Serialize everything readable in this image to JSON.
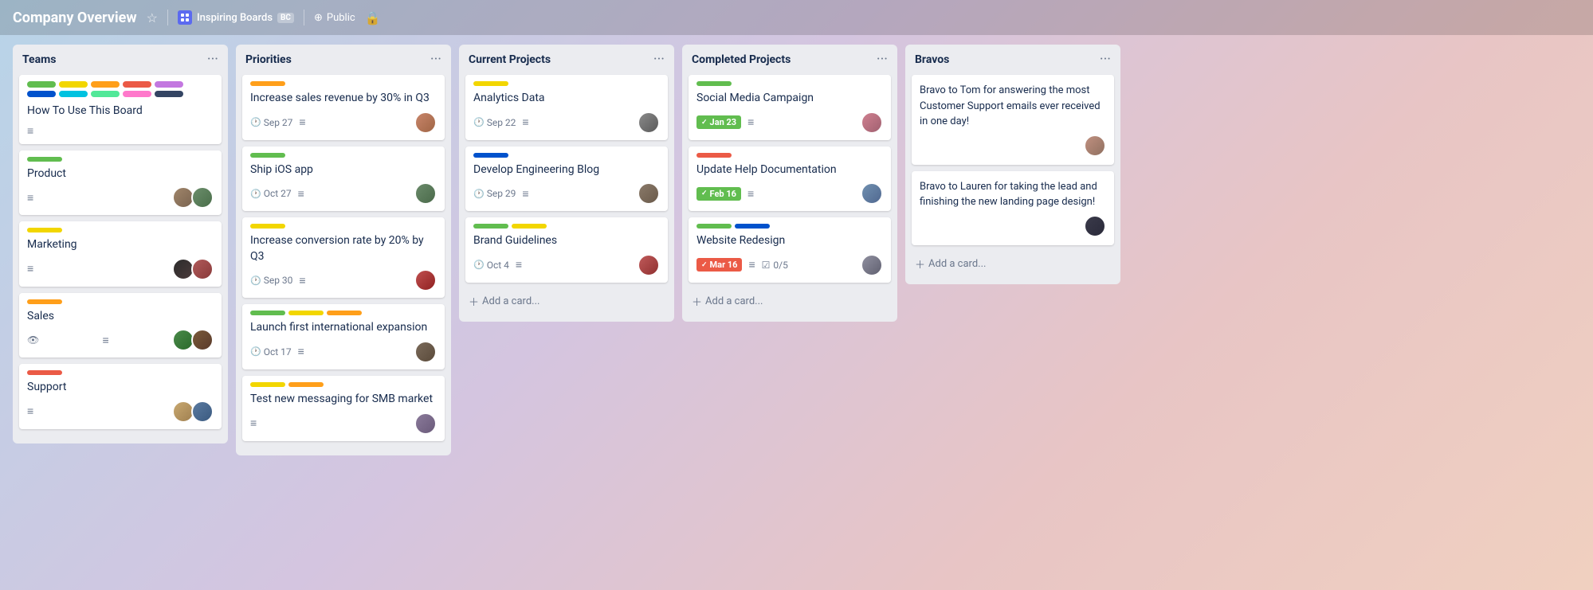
{
  "header": {
    "title": "Company Overview",
    "workspace_name": "Inspiring Boards",
    "workspace_badge": "BC",
    "public_label": "Public"
  },
  "columns": [
    {
      "id": "teams",
      "title": "Teams",
      "cards": [
        {
          "id": "how-to",
          "labels": [
            "#61bd4f",
            "#f2d600",
            "#ff9f1a",
            "#eb5a46",
            "#c377e0",
            "#0052cc",
            "#00c2e0",
            "#51e898",
            "#ff78cb",
            "#344563"
          ],
          "title": "How To Use This Board",
          "has_desc": true,
          "avatars": []
        },
        {
          "id": "product",
          "label_color": "#61bd4f",
          "title": "Product",
          "has_desc": true,
          "avatars": [
            "a",
            "b"
          ]
        },
        {
          "id": "marketing",
          "label_color": "#f2d600",
          "title": "Marketing",
          "has_desc": true,
          "avatars": [
            "c",
            "d"
          ]
        },
        {
          "id": "sales",
          "label_color": "#ff9f1a",
          "title": "Sales",
          "has_desc": true,
          "avatars": [
            "e",
            "f"
          ]
        },
        {
          "id": "support",
          "label_color": "#eb5a46",
          "title": "Support",
          "has_desc": true,
          "avatars": [
            "g",
            "h"
          ]
        }
      ]
    },
    {
      "id": "priorities",
      "title": "Priorities",
      "cards": [
        {
          "id": "sales-revenue",
          "label_color": "#ff9f1a",
          "title": "Increase sales revenue by 30% in Q3",
          "date": "Sep 27",
          "has_desc": true,
          "avatars": [
            "i"
          ]
        },
        {
          "id": "ios-app",
          "label_color": "#61bd4f",
          "title": "Ship iOS app",
          "date": "Oct 27",
          "has_desc": true,
          "avatars": [
            "a"
          ]
        },
        {
          "id": "conversion",
          "label_color": "#f2d600",
          "title": "Increase conversion rate by 20% by Q3",
          "date": "Sep 30",
          "has_desc": true,
          "avatars": [
            "d"
          ]
        },
        {
          "id": "international",
          "label_color": "#61bd4f",
          "title": "Launch first international expansion",
          "date": "Oct 17",
          "has_desc": true,
          "avatars": [
            "b"
          ]
        },
        {
          "id": "smb",
          "label_color": "#f2d600",
          "title": "Test new messaging for SMB market",
          "has_desc": true,
          "avatars": [
            "c"
          ]
        }
      ]
    },
    {
      "id": "current-projects",
      "title": "Current Projects",
      "cards": [
        {
          "id": "analytics",
          "label_color": "#f2d600",
          "title": "Analytics Data",
          "date": "Sep 22",
          "has_desc": true,
          "avatars": [
            "e"
          ]
        },
        {
          "id": "eng-blog",
          "label_color": "#0052cc",
          "title": "Develop Engineering Blog",
          "date": "Sep 29",
          "has_desc": true,
          "avatars": [
            "f"
          ]
        },
        {
          "id": "brand",
          "label_color": "#61bd4f",
          "title": "Brand Guidelines",
          "date": "Oct 4",
          "has_desc": true,
          "avatars": [
            "g"
          ]
        }
      ],
      "add_card": "Add a card..."
    },
    {
      "id": "completed-projects",
      "title": "Completed Projects",
      "cards": [
        {
          "id": "social-media",
          "label_color": "#61bd4f",
          "title": "Social Media Campaign",
          "badge": "green",
          "badge_text": "Jan 23",
          "has_desc": true,
          "avatars": [
            "h"
          ]
        },
        {
          "id": "help-docs",
          "label_color": "#eb5a46",
          "title": "Update Help Documentation",
          "badge": "green",
          "badge_text": "Feb 16",
          "has_desc": true,
          "avatars": [
            "i"
          ]
        },
        {
          "id": "website",
          "label_color_1": "#61bd4f",
          "label_color_2": "#0052cc",
          "title": "Website Redesign",
          "badge": "red",
          "badge_text": "Mar 16",
          "checklist": "0/5",
          "has_desc": true,
          "avatars": [
            "a"
          ]
        }
      ],
      "add_card": "Add a card..."
    },
    {
      "id": "bravos",
      "title": "Bravos",
      "bravos": [
        {
          "text": "Bravo to Tom for answering the most Customer Support emails ever received in one day!",
          "avatar": "b"
        },
        {
          "text": "Bravo to Lauren for taking the lead and finishing the new landing page design!",
          "avatar": "c"
        }
      ],
      "add_card": "Add a card..."
    }
  ]
}
